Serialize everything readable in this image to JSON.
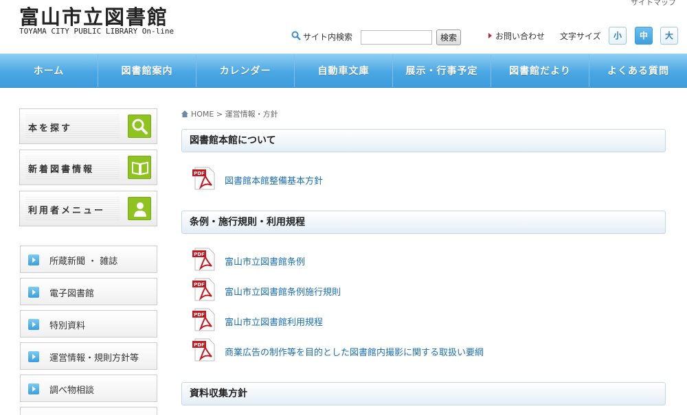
{
  "header": {
    "logo_jp": "富山市立図書館",
    "logo_en": "TOYAMA CITY PUBLIC LIBRARY On-line",
    "sitemap": "サイトマップ",
    "search_label": "サイト内検索",
    "search_value": "",
    "search_button": "検索",
    "contact": "お問い合わせ",
    "fontsize_label": "文字サイズ",
    "fontsize_small": "小",
    "fontsize_medium": "中",
    "fontsize_large": "大",
    "fontsize_active": "中"
  },
  "nav": {
    "items": [
      "ホーム",
      "図書館案内",
      "カレンダー",
      "自動車文庫",
      "展示・行事予定",
      "図書館だより",
      "よくある質問"
    ]
  },
  "sidebar": {
    "big_buttons": [
      {
        "label": "本を探す",
        "icon": "search-icon"
      },
      {
        "label": "新着図書情報",
        "icon": "book-icon"
      },
      {
        "label": "利用者メニュー",
        "icon": "user-icon"
      }
    ],
    "links": [
      "所蔵新聞 ・ 雑誌",
      "電子図書館",
      "特別資料",
      "運営情報・規則方針等",
      "調べ物相談"
    ]
  },
  "breadcrumb": {
    "home": "HOME",
    "separator": ">",
    "current": "運営情報・方針"
  },
  "sections": [
    {
      "title": "図書館本館について",
      "items": [
        "図書館本館整備基本方針"
      ]
    },
    {
      "title": "条例・施行規則・利用規程",
      "items": [
        "富山市立図書館条例",
        "富山市立図書館条例施行規則",
        "富山市立図書館利用規程",
        "商業広告の制作等を目的とした図書館内撮影に関する取扱い要綱"
      ]
    },
    {
      "title": "資料収集方針",
      "items": []
    }
  ],
  "colors": {
    "nav_blue": "#4aa7e3",
    "link_blue": "#1a6fb3",
    "icon_green": "#8fc31f",
    "pdf_red": "#c8161d"
  }
}
